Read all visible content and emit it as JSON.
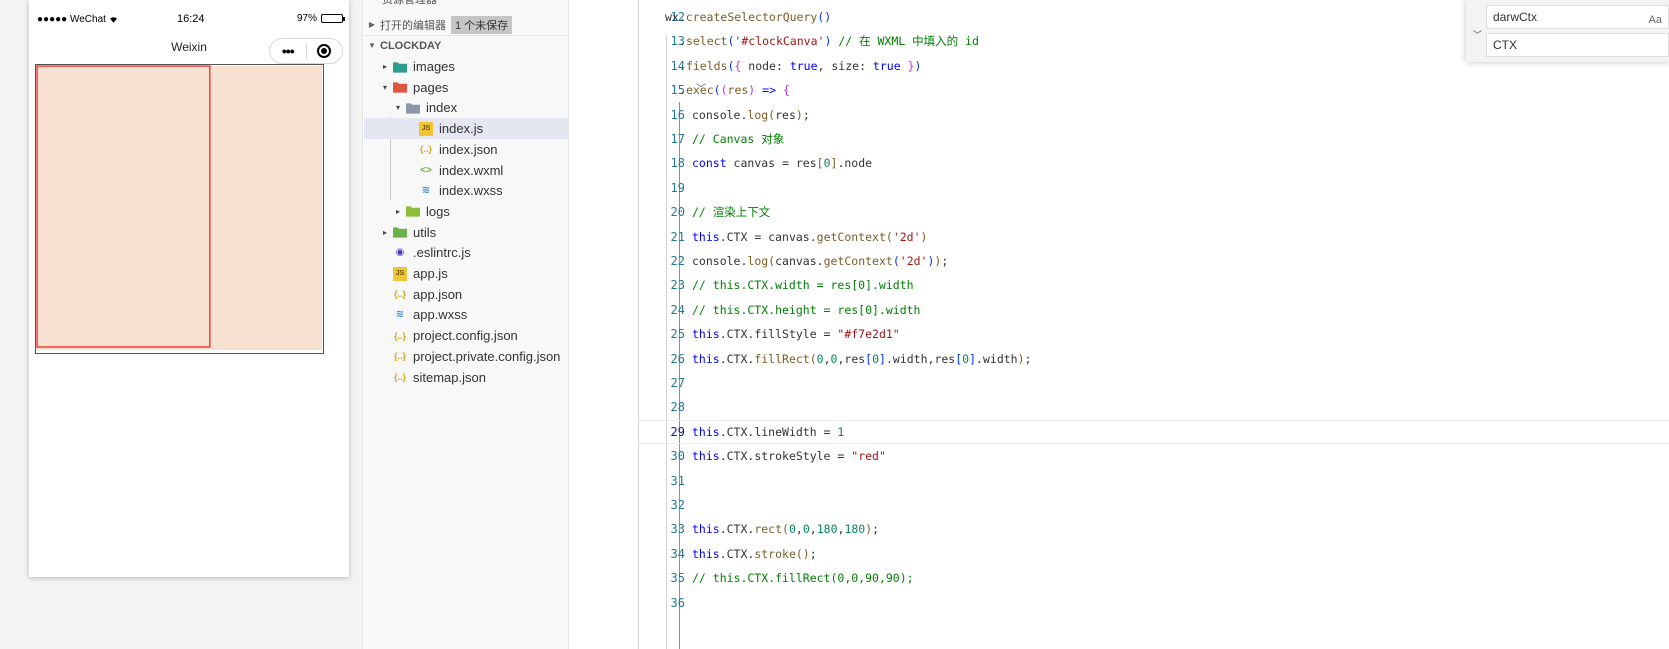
{
  "simulator": {
    "status_left": "●●●●● WeChat",
    "wifi_icon": "wifi-icon",
    "time": "16:24",
    "battery": "97%",
    "battery_level": 0.97,
    "nav_title": "Weixin",
    "capsule_more": "•••",
    "canvas": {
      "bg_color": "#f7e2d1",
      "stroke_color": "red",
      "size": 180,
      "display_width": 289,
      "display_height": 290
    }
  },
  "explorer": {
    "sections": [
      {
        "label": "打开的编辑器",
        "badge": "1 个未保存",
        "expanded": false
      },
      {
        "label": "CLOCKDAY",
        "expanded": true
      }
    ],
    "tree": [
      {
        "label": "images",
        "type": "folder",
        "icon": "folder-images-icon",
        "color": "#2e9c8f",
        "depth": 1,
        "twisty": "▸"
      },
      {
        "label": "pages",
        "type": "folder",
        "icon": "folder-pages-icon",
        "color": "#e0553f",
        "depth": 1,
        "twisty": "▾"
      },
      {
        "label": "index",
        "type": "folder",
        "icon": "folder-open-icon",
        "color": "#8c98a8",
        "depth": 2,
        "twisty": "▾"
      },
      {
        "label": "index.js",
        "type": "file",
        "icon": "js-file-icon",
        "color": "#f0c433",
        "depth": 3,
        "selected": true
      },
      {
        "label": "index.json",
        "type": "file",
        "icon": "json-file-icon",
        "color": "#d7a31c",
        "depth": 3
      },
      {
        "label": "index.wxml",
        "type": "file",
        "icon": "wxml-file-icon",
        "color": "#6ab04c",
        "depth": 3
      },
      {
        "label": "index.wxss",
        "type": "file",
        "icon": "wxss-file-icon",
        "color": "#3b8fd8",
        "depth": 3
      },
      {
        "label": "logs",
        "type": "folder",
        "icon": "folder-icon",
        "color": "#8cbe3a",
        "depth": 2,
        "twisty": "▸"
      },
      {
        "label": "utils",
        "type": "folder",
        "icon": "folder-utils-icon",
        "color": "#6ab04c",
        "depth": 1,
        "twisty": "▸"
      },
      {
        "label": ".eslintrc.js",
        "type": "file",
        "icon": "eslint-file-icon",
        "color": "#4b32c3",
        "depth": 1
      },
      {
        "label": "app.js",
        "type": "file",
        "icon": "js-file-icon",
        "color": "#f0c433",
        "depth": 1
      },
      {
        "label": "app.json",
        "type": "file",
        "icon": "json-file-icon",
        "color": "#d7a31c",
        "depth": 1
      },
      {
        "label": "app.wxss",
        "type": "file",
        "icon": "wxss-file-icon",
        "color": "#3b8fd8",
        "depth": 1
      },
      {
        "label": "project.config.json",
        "type": "file",
        "icon": "json-file-icon",
        "color": "#d7a31c",
        "depth": 1
      },
      {
        "label": "project.private.config.json",
        "type": "file",
        "icon": "json-file-icon",
        "color": "#d7a31c",
        "depth": 1
      },
      {
        "label": "sitemap.json",
        "type": "file",
        "icon": "json-file-icon",
        "color": "#d7a31c",
        "depth": 1
      }
    ]
  },
  "editor": {
    "active_line": 29,
    "lines": [
      {
        "num": 12,
        "indent": 1,
        "tokens": [
          [
            "t",
            "wx."
          ],
          [
            "f",
            "createSelectorQuery"
          ],
          [
            "b1",
            "()"
          ]
        ]
      },
      {
        "num": 13,
        "indent": 2,
        "tokens": [
          [
            "t",
            "."
          ],
          [
            "f",
            "select"
          ],
          [
            "b1",
            "("
          ],
          [
            "s",
            "'#clockCanva'"
          ],
          [
            "b1",
            ")"
          ],
          [
            "t",
            " "
          ],
          [
            "c",
            "// 在 WXML 中填入的 id"
          ]
        ]
      },
      {
        "num": 14,
        "indent": 2,
        "tokens": [
          [
            "t",
            "."
          ],
          [
            "f",
            "fields"
          ],
          [
            "b1",
            "("
          ],
          [
            "b2",
            "{"
          ],
          [
            "t",
            " node: "
          ],
          [
            "k",
            "true"
          ],
          [
            "t",
            ", size: "
          ],
          [
            "k",
            "true"
          ],
          [
            "t",
            " "
          ],
          [
            "b2",
            "}"
          ],
          [
            "b1",
            ")"
          ]
        ]
      },
      {
        "num": 15,
        "indent": 2,
        "fold": true,
        "tokens": [
          [
            "t",
            "."
          ],
          [
            "f",
            "exec"
          ],
          [
            "b1",
            "("
          ],
          [
            "b2",
            "("
          ],
          [
            "p",
            "res"
          ],
          [
            "b2",
            ")"
          ],
          [
            "t",
            " "
          ],
          [
            "k",
            "=>"
          ],
          [
            "t",
            " "
          ],
          [
            "b2",
            "{"
          ]
        ]
      },
      {
        "num": 16,
        "indent": 3,
        "tokens": [
          [
            "t",
            "console."
          ],
          [
            "f",
            "log"
          ],
          [
            "b3",
            "("
          ],
          [
            "t",
            "res"
          ],
          [
            "b3",
            ")"
          ],
          [
            "t",
            ";"
          ]
        ]
      },
      {
        "num": 17,
        "indent": 3,
        "tokens": [
          [
            "c",
            "// Canvas 对象"
          ]
        ]
      },
      {
        "num": 18,
        "indent": 3,
        "tokens": [
          [
            "k",
            "const"
          ],
          [
            "t",
            " canvas = res"
          ],
          [
            "b3",
            "["
          ],
          [
            "n",
            "0"
          ],
          [
            "b3",
            "]"
          ],
          [
            "t",
            ".node"
          ]
        ]
      },
      {
        "num": 19,
        "indent": 3,
        "tokens": []
      },
      {
        "num": 20,
        "indent": 3,
        "tokens": [
          [
            "c",
            "// 渲染上下文"
          ]
        ]
      },
      {
        "num": 21,
        "indent": 3,
        "tokens": [
          [
            "k",
            "this"
          ],
          [
            "t",
            ".CTX = canvas."
          ],
          [
            "f",
            "getContext"
          ],
          [
            "b3",
            "("
          ],
          [
            "s",
            "'2d'"
          ],
          [
            "b3",
            ")"
          ]
        ]
      },
      {
        "num": 22,
        "indent": 3,
        "tokens": [
          [
            "t",
            "console."
          ],
          [
            "f",
            "log"
          ],
          [
            "b3",
            "("
          ],
          [
            "t",
            "canvas."
          ],
          [
            "f",
            "getContext"
          ],
          [
            "b1",
            "("
          ],
          [
            "s",
            "'2d'"
          ],
          [
            "b1",
            ")"
          ],
          [
            "b3",
            ")"
          ],
          [
            "t",
            ";"
          ]
        ]
      },
      {
        "num": 23,
        "indent": 3,
        "tokens": [
          [
            "c",
            "// this.CTX.width = res[0].width"
          ]
        ]
      },
      {
        "num": 24,
        "indent": 3,
        "tokens": [
          [
            "c",
            "// this.CTX.height = res[0].width"
          ]
        ]
      },
      {
        "num": 25,
        "indent": 3,
        "tokens": [
          [
            "k",
            "this"
          ],
          [
            "t",
            ".CTX.fillStyle = "
          ],
          [
            "s",
            "\"#f7e2d1\""
          ]
        ]
      },
      {
        "num": 26,
        "indent": 3,
        "tokens": [
          [
            "k",
            "this"
          ],
          [
            "t",
            ".CTX."
          ],
          [
            "f",
            "fillRect"
          ],
          [
            "b3",
            "("
          ],
          [
            "n",
            "0"
          ],
          [
            "t",
            ","
          ],
          [
            "n",
            "0"
          ],
          [
            "t",
            ",res"
          ],
          [
            "b1",
            "["
          ],
          [
            "n",
            "0"
          ],
          [
            "b1",
            "]"
          ],
          [
            "t",
            ".width,res"
          ],
          [
            "b1",
            "["
          ],
          [
            "n",
            "0"
          ],
          [
            "b1",
            "]"
          ],
          [
            "t",
            ".width"
          ],
          [
            "b3",
            ")"
          ],
          [
            "t",
            ";"
          ]
        ]
      },
      {
        "num": 27,
        "indent": 3,
        "tokens": []
      },
      {
        "num": 28,
        "indent": 3,
        "tokens": []
      },
      {
        "num": 29,
        "indent": 3,
        "tokens": [
          [
            "k",
            "this"
          ],
          [
            "t",
            ".CTX.lineWidth = "
          ],
          [
            "n",
            "1"
          ]
        ]
      },
      {
        "num": 30,
        "indent": 3,
        "tokens": [
          [
            "k",
            "this"
          ],
          [
            "t",
            ".CTX.strokeStyle = "
          ],
          [
            "s",
            "\"red\""
          ]
        ]
      },
      {
        "num": 31,
        "indent": 3,
        "tokens": []
      },
      {
        "num": 32,
        "indent": 3,
        "tokens": []
      },
      {
        "num": 33,
        "indent": 3,
        "tokens": [
          [
            "k",
            "this"
          ],
          [
            "t",
            ".CTX."
          ],
          [
            "f",
            "rect"
          ],
          [
            "b3",
            "("
          ],
          [
            "n",
            "0"
          ],
          [
            "t",
            ","
          ],
          [
            "n",
            "0"
          ],
          [
            "t",
            ","
          ],
          [
            "n",
            "180"
          ],
          [
            "t",
            ","
          ],
          [
            "n",
            "180"
          ],
          [
            "b3",
            ")"
          ],
          [
            "t",
            ";"
          ]
        ]
      },
      {
        "num": 34,
        "indent": 3,
        "tokens": [
          [
            "k",
            "this"
          ],
          [
            "t",
            ".CTX."
          ],
          [
            "f",
            "stroke"
          ],
          [
            "b3",
            "()"
          ],
          [
            "t",
            ";"
          ]
        ]
      },
      {
        "num": 35,
        "indent": 3,
        "tokens": [
          [
            "c",
            "// this.CTX.fillRect(0,0,90,90);"
          ]
        ]
      },
      {
        "num": 36,
        "indent": 3,
        "tokens": []
      }
    ]
  },
  "find": {
    "search_value": "darwCtx",
    "replace_value": "CTX",
    "option_label": "Aa"
  }
}
